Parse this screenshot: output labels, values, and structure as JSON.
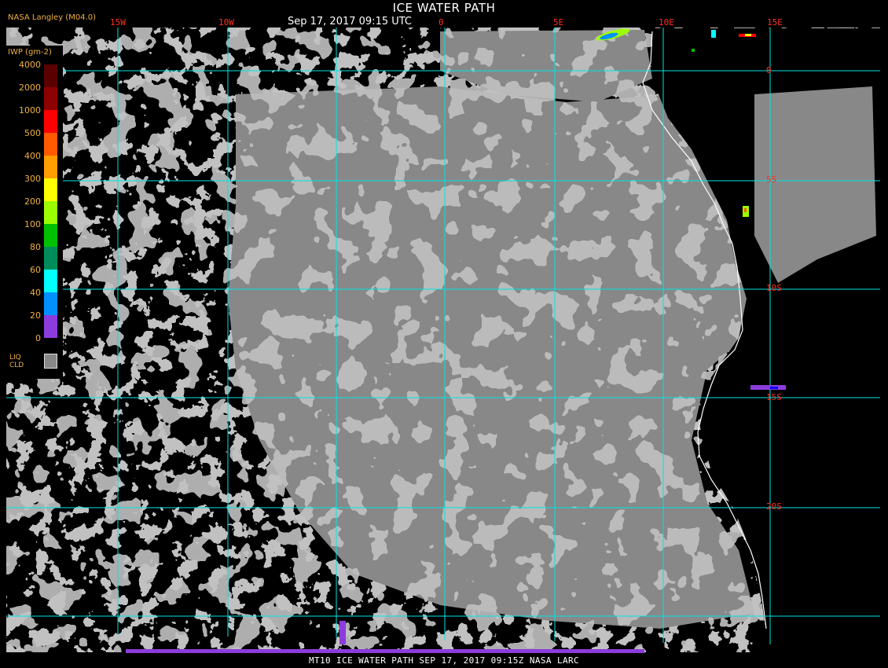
{
  "header": {
    "title": "ICE WATER PATH",
    "subtitle": "Sep 17, 2017 09:15 UTC",
    "producer": "NASA Langley (M04.0)"
  },
  "map": {
    "longitude_labels": [
      "15W",
      "10W",
      "0",
      "5E",
      "10E",
      "15E"
    ],
    "latitude_labels": [
      "0",
      "5S",
      "10S",
      "15S",
      "20S"
    ],
    "colors": {
      "background": "#000000",
      "liquid_cloud": "#888888",
      "grid": "#00e5e5",
      "coastline": "#ffffff",
      "grid_label": "#ff3020"
    }
  },
  "legend": {
    "title": "IWP (gm-2)",
    "levels": [
      {
        "label": "4000",
        "color": "#5a0000"
      },
      {
        "label": "2000",
        "color": "#8c0000"
      },
      {
        "label": "1000",
        "color": "#ff0000"
      },
      {
        "label": "500",
        "color": "#ff5a00"
      },
      {
        "label": "400",
        "color": "#ff9c00"
      },
      {
        "label": "300",
        "color": "#ffff00"
      },
      {
        "label": "200",
        "color": "#9cff00"
      },
      {
        "label": "100",
        "color": "#00c000"
      },
      {
        "label": "80",
        "color": "#008c5a"
      },
      {
        "label": "60",
        "color": "#00ffff"
      },
      {
        "label": "40",
        "color": "#0090ff"
      },
      {
        "label": "20",
        "color": "#0000ff"
      },
      {
        "label": "0",
        "color": "#8c3cdc"
      }
    ],
    "liq_label_line1": "LIQ",
    "liq_label_line2": "CLD"
  },
  "footer": {
    "text": "MT10  ICE WATER PATH  SEP 17, 2017 09:15Z  NASA LARC"
  }
}
